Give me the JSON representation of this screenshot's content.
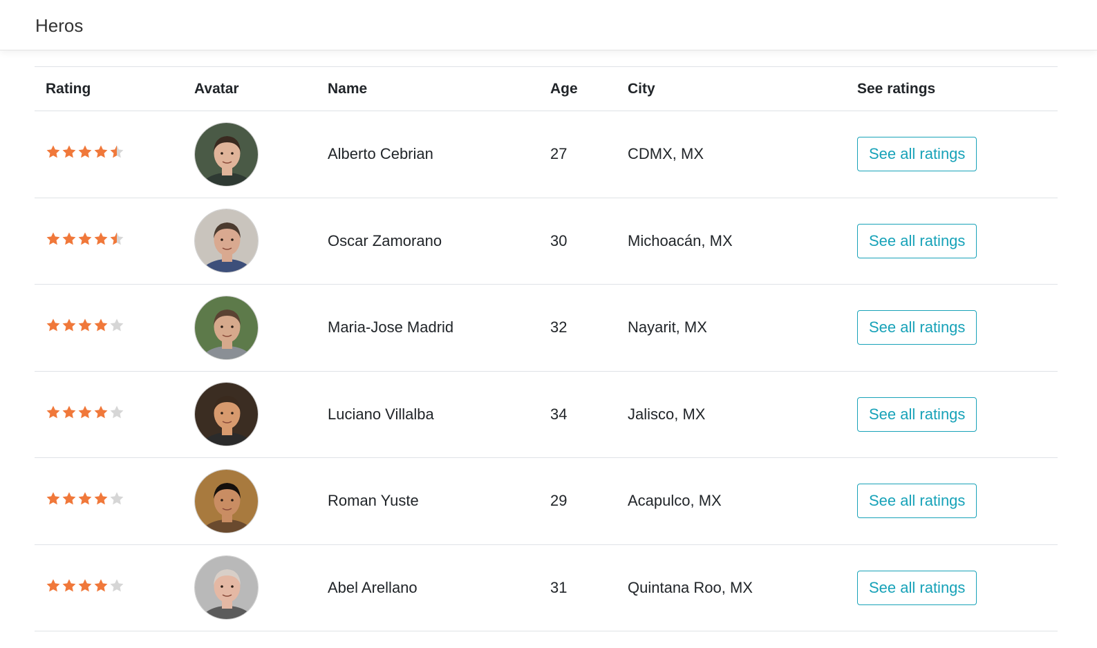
{
  "app": {
    "title": "Heros"
  },
  "table": {
    "headers": {
      "rating": "Rating",
      "avatar": "Avatar",
      "name": "Name",
      "age": "Age",
      "city": "City",
      "see_ratings": "See ratings"
    },
    "rows": [
      {
        "rating": 4.5,
        "name": "Alberto Cebrian",
        "age": "27",
        "city": "CDMX, MX",
        "button": "See all ratings",
        "avatar": {
          "bg": "#4a5a46",
          "skin": "#e0b49a",
          "hair": "#3a2a20",
          "shirt": "#2f3a33"
        }
      },
      {
        "rating": 4.5,
        "name": "Oscar Zamorano",
        "age": "30",
        "city": "Michoacán, MX",
        "button": "See all ratings",
        "avatar": {
          "bg": "#c9c4bd",
          "skin": "#d9a990",
          "hair": "#4b3b2f",
          "shirt": "#3d4f7a"
        }
      },
      {
        "rating": 4,
        "name": "Maria-Jose Madrid",
        "age": "32",
        "city": "Nayarit, MX",
        "button": "See all ratings",
        "avatar": {
          "bg": "#5d7a4a",
          "skin": "#d6a98c",
          "hair": "#5a4232",
          "shirt": "#8a8f95"
        }
      },
      {
        "rating": 4,
        "name": "Luciano Villalba",
        "age": "34",
        "city": "Jalisco, MX",
        "button": "See all ratings",
        "avatar": {
          "bg": "#3b2d22",
          "skin": "#d79a6e",
          "hair": "#3a2a1e",
          "shirt": "#2b2b2b"
        }
      },
      {
        "rating": 4,
        "name": "Roman Yuste",
        "age": "29",
        "city": "Acapulco, MX",
        "button": "See all ratings",
        "avatar": {
          "bg": "#a87a3e",
          "skin": "#c98d63",
          "hair": "#15100c",
          "shirt": "#6a4a2e"
        }
      },
      {
        "rating": 4,
        "name": "Abel Arellano",
        "age": "31",
        "city": "Quintana Roo, MX",
        "button": "See all ratings",
        "avatar": {
          "bg": "#b9b9b9",
          "skin": "#e4b8a4",
          "hair": "#d8cfc8",
          "shirt": "#5b5b5b"
        }
      }
    ]
  },
  "colors": {
    "star_on": "#f0783a",
    "star_off": "#d6d6d6",
    "accent": "#17a2b8",
    "border": "#dee2e6"
  }
}
